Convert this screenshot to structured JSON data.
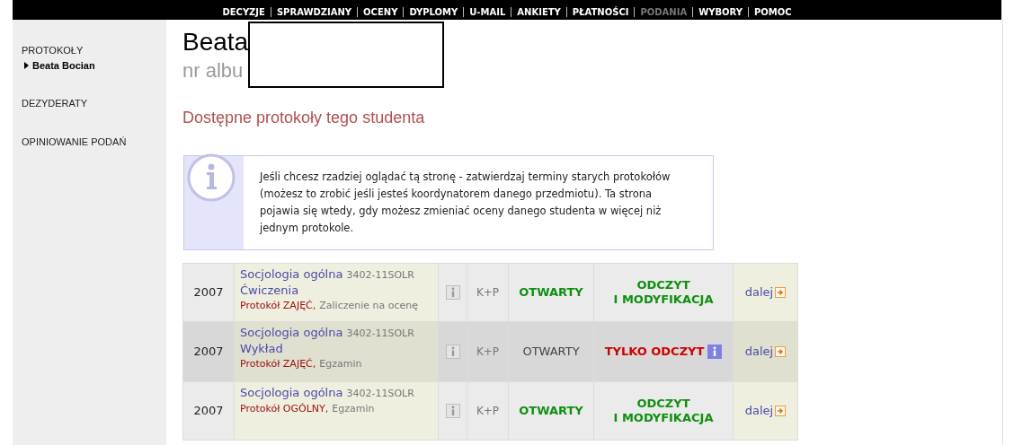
{
  "top_nav": [
    {
      "label": "DECYZJE",
      "selected": false
    },
    {
      "label": "SPRAWDZIANY",
      "selected": false
    },
    {
      "label": "OCENY",
      "selected": false
    },
    {
      "label": "DYPLOMY",
      "selected": false
    },
    {
      "label": "U-MAIL",
      "selected": false
    },
    {
      "label": "ANKIETY",
      "selected": false
    },
    {
      "label": "PŁATNOŚCI",
      "selected": false
    },
    {
      "label": "PODANIA",
      "selected": true
    },
    {
      "label": "WYBORY",
      "selected": false
    },
    {
      "label": "POMOC",
      "selected": false
    }
  ],
  "sidebar": {
    "items": [
      {
        "label": "PROTOKOŁY",
        "children": [
          {
            "label": "Beata Bocian",
            "selected": true
          }
        ]
      },
      {
        "label": "DEZYDERATY"
      },
      {
        "label": "OPINIOWANIE PODAŃ"
      }
    ]
  },
  "header": {
    "name": "Beata",
    "album": "nr albu"
  },
  "section_title": "Dostępne protokoły tego studenta",
  "info_box": "Jeśli chcesz rzadziej oglądać tą stronę - zatwierdzaj terminy starych protokołów (możesz to zrobić jeśli jesteś koordynatorem danego przedmiotu). Ta strona pojawia się wtedy, gdy możesz zmieniać oceny danego studenta w więcej niż jednym protokole.",
  "rows": [
    {
      "year": "2007",
      "course": "Socjologia ogólna",
      "code": "3402-11SOLR",
      "class_type": "Ćwiczenia",
      "protocol": "Protokół ZAJĘĆ,",
      "assessment": "Zaliczenie na ocenę",
      "mode": "K+P",
      "status": "OTWARTY",
      "status_active": true,
      "access": [
        "ODCZYT",
        "I MODYFIKACJA"
      ],
      "read_only": false,
      "link": "dalej"
    },
    {
      "year": "2007",
      "course": "Socjologia ogólna",
      "code": "3402-11SOLR",
      "class_type": "Wykład",
      "protocol": "Protokół ZAJĘĆ,",
      "assessment": "Egzamin",
      "mode": "K+P",
      "status": "OTWARTY",
      "status_active": false,
      "access": [
        "TYLKO ODCZYT"
      ],
      "read_only": true,
      "link": "dalej"
    },
    {
      "year": "2007",
      "course": "Socjologia ogólna",
      "code": "3402-11SOLR",
      "protocol": "Protokół OGÓLNY,",
      "assessment": "Egzamin",
      "mode": "K+P",
      "status": "OTWARTY",
      "status_active": true,
      "access": [
        "ODCZYT",
        "I MODYFIKACJA"
      ],
      "read_only": false,
      "link": "dalej"
    }
  ]
}
